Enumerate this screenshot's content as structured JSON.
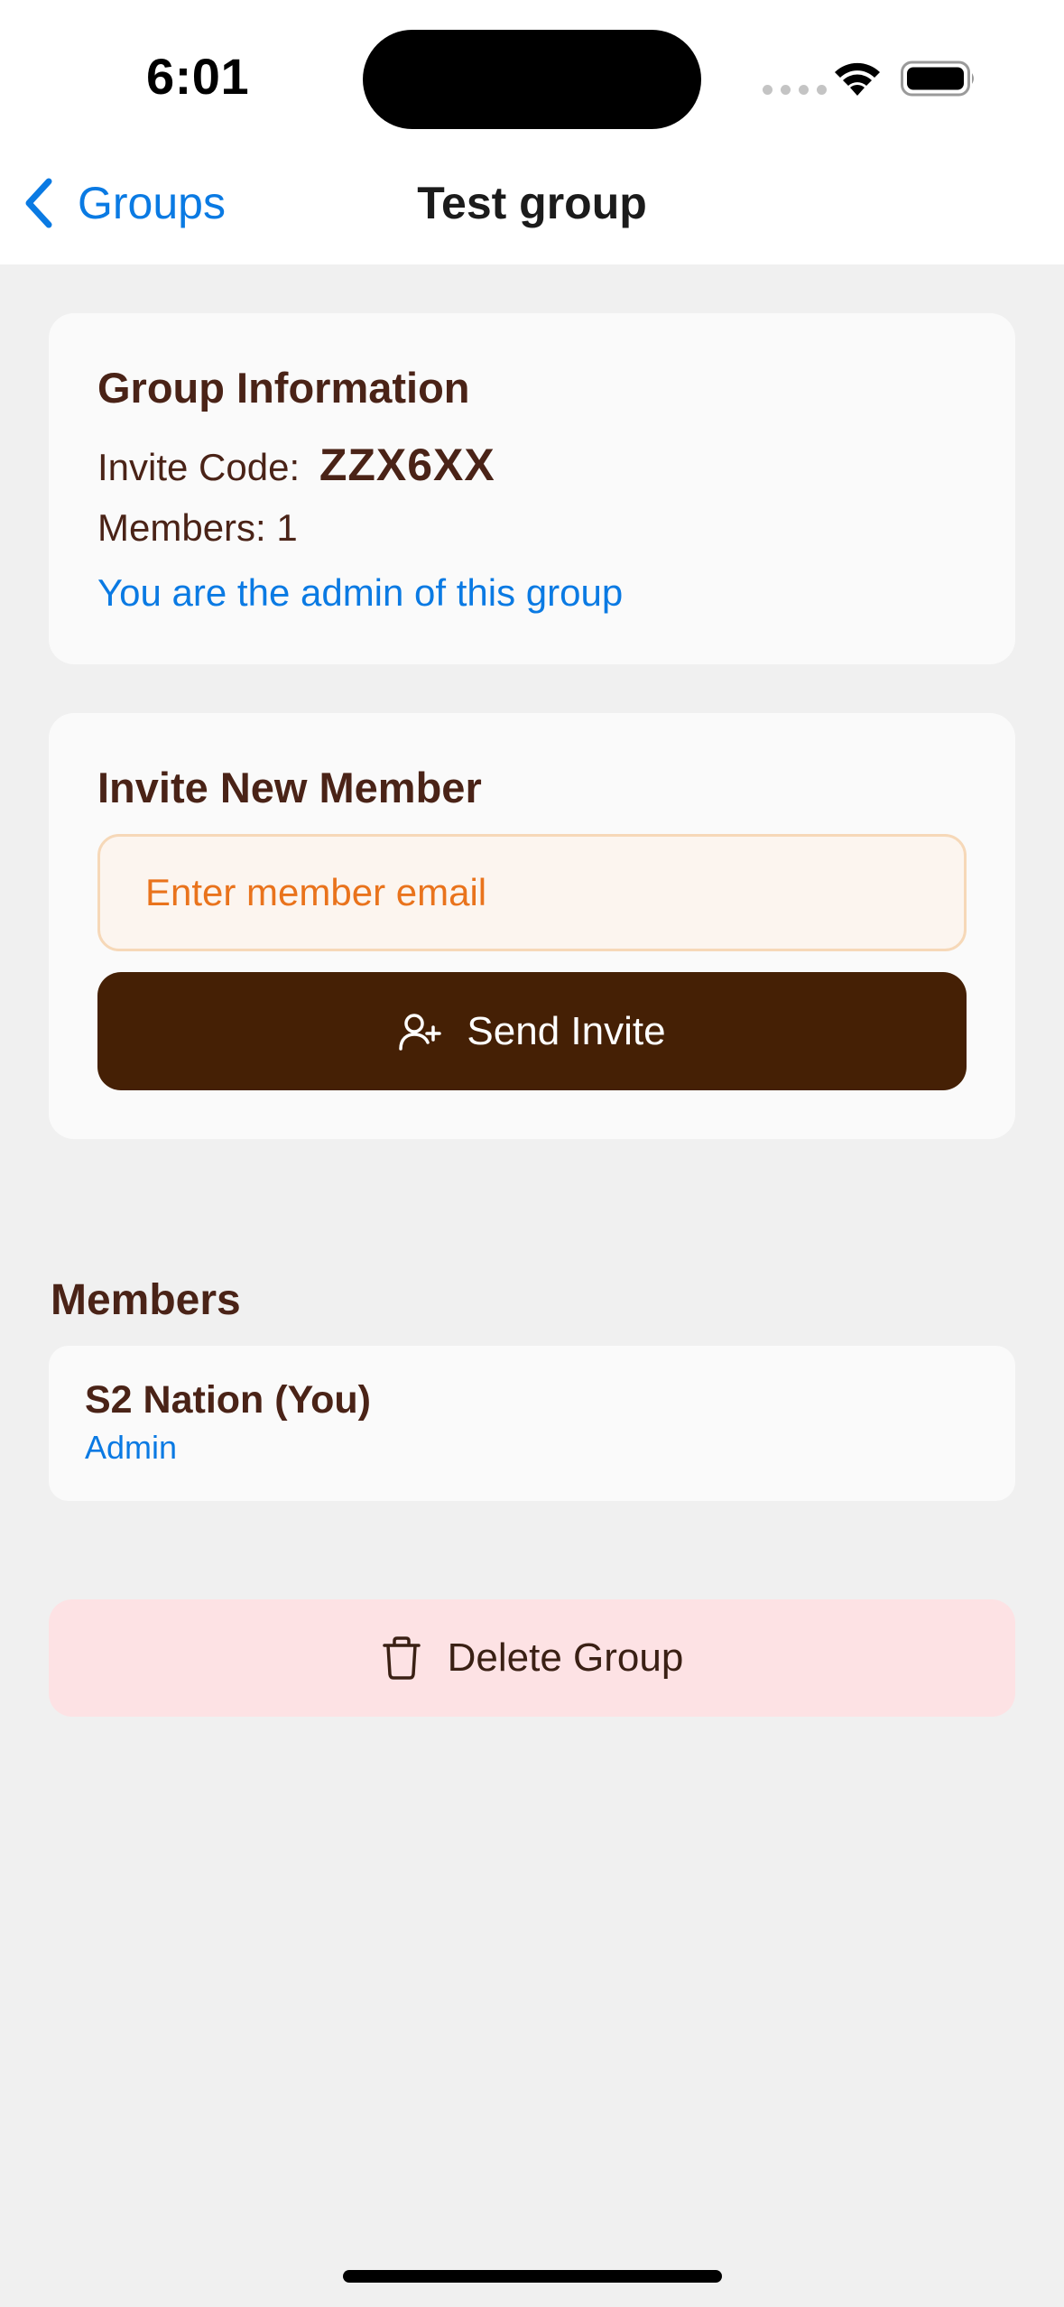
{
  "status_bar": {
    "time": "6:01"
  },
  "nav": {
    "back_label": "Groups",
    "title": "Test group"
  },
  "group_info": {
    "title": "Group Information",
    "invite_code_label": "Invite Code:",
    "invite_code": "ZZX6XX",
    "members_label": "Members: 1",
    "admin_note": "You are the admin of this group"
  },
  "invite": {
    "title": "Invite New Member",
    "email_placeholder": "Enter member email",
    "send_label": "Send Invite"
  },
  "members": {
    "heading": "Members",
    "items": [
      {
        "name": "S2 Nation (You)",
        "role": "Admin"
      }
    ]
  },
  "delete": {
    "label": "Delete Group"
  },
  "colors": {
    "accent_blue": "#0a7ae3",
    "brown_text": "#4a2317",
    "send_button_bg": "#452005",
    "delete_bg": "#fde2e4",
    "input_placeholder": "#e9731c"
  },
  "icons": {
    "back": "chevron-left-icon",
    "send": "user-plus-icon",
    "delete": "trash-icon"
  }
}
